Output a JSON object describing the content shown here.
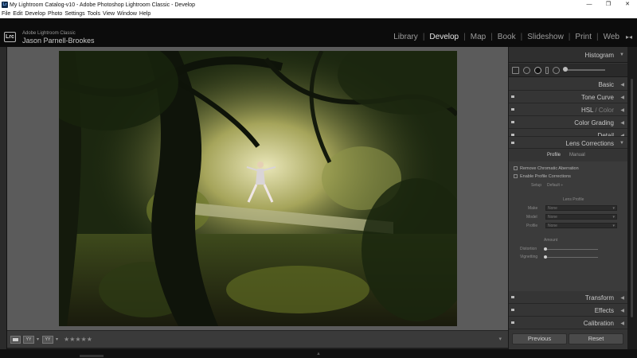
{
  "window": {
    "title": "My Lightroom Catalog-v10 - Adobe Photoshop Lightroom Classic - Develop",
    "app_icon": "Lr",
    "minimize_glyph": "—",
    "maximize_glyph": "❐",
    "close_glyph": "✕"
  },
  "menubar": [
    "File",
    "Edit",
    "Develop",
    "Photo",
    "Settings",
    "Tools",
    "View",
    "Window",
    "Help"
  ],
  "identity": {
    "logo": "Lrc",
    "app_name": "Adobe Lightroom Classic",
    "user_name": "Jason Parnell-Brookes"
  },
  "modules": {
    "items": [
      "Library",
      "Develop",
      "Map",
      "Book",
      "Slideshow",
      "Print",
      "Web"
    ],
    "active": "Develop",
    "collapse_glyph": "▸◂"
  },
  "panels": {
    "histogram": "Histogram",
    "basic": "Basic",
    "tone_curve": "Tone Curve",
    "hsl": "HSL",
    "hsl_sep": " / ",
    "color": "Color",
    "color_grading": "Color Grading",
    "detail": "Detail",
    "lens_corrections": "Lens Corrections",
    "transform": "Transform",
    "effects": "Effects",
    "calibration": "Calibration",
    "expanded_glyph": "▼",
    "collapsed_glyph": "◀"
  },
  "lens": {
    "tab_profile": "Profile",
    "tab_manual": "Manual",
    "remove_ca": "Remove Chromatic Aberration",
    "enable_profile": "Enable Profile Corrections",
    "setup_label": "Setup",
    "setup_value": "Default ÷",
    "lens_profile_heading": "Lens Profile",
    "make_label": "Make",
    "model_label": "Model",
    "profile_label": "Profile",
    "make_value": "None",
    "model_value": "None",
    "profile_value": "None",
    "amount_heading": "Amount",
    "distortion_label": "Distortion",
    "vignetting_label": "Vignetting"
  },
  "buttons": {
    "previous": "Previous",
    "reset": "Reset"
  },
  "toolbar": {
    "yy_label": "YY",
    "stars": "★★★★★",
    "caret": "▾",
    "right_caret": "▾"
  },
  "bottom_marker": "▲"
}
